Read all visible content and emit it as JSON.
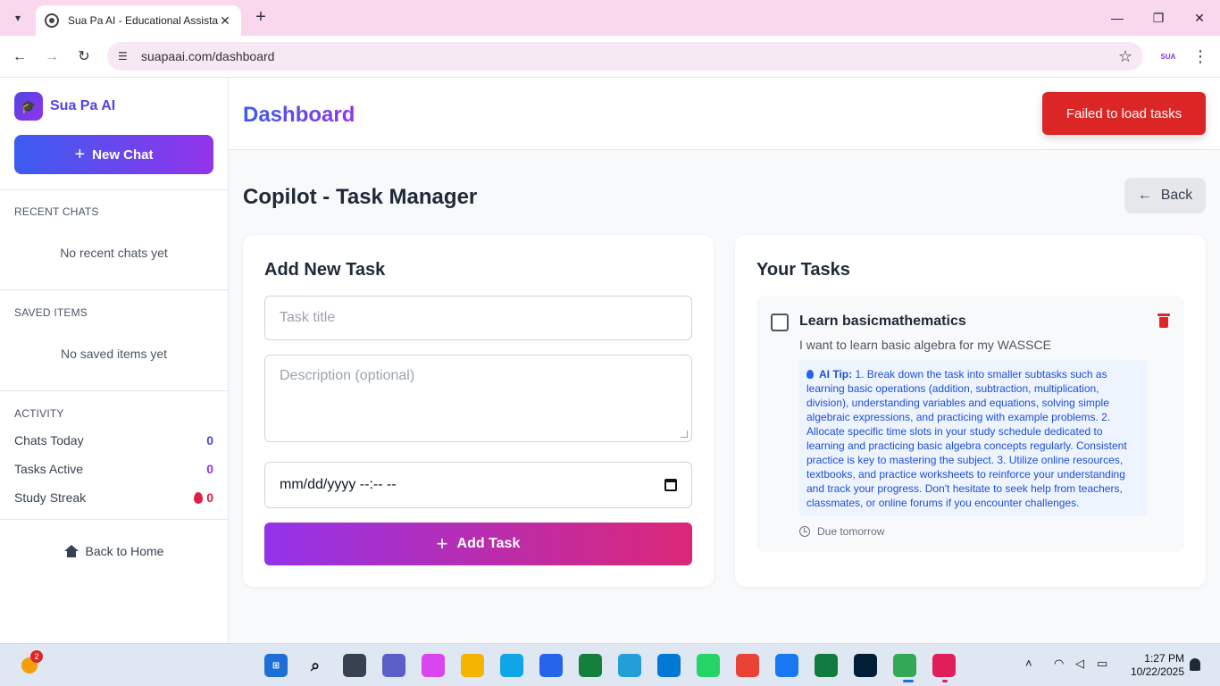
{
  "browser": {
    "tab_title": "Sua Pa AI - Educational Assistant",
    "tab_close": "✕",
    "new_tab": "+",
    "url": "suapaai.com/dashboard",
    "profile_label": "SUA"
  },
  "sidebar": {
    "brand": "Sua Pa AI",
    "new_chat_label": "New Chat",
    "recent_chats": {
      "title": "RECENT CHATS",
      "empty": "No recent chats yet"
    },
    "saved_items": {
      "title": "SAVED ITEMS",
      "empty": "No saved items yet"
    },
    "activity": {
      "title": "ACTIVITY",
      "items": [
        {
          "label": "Chats Today",
          "value": "0"
        },
        {
          "label": "Tasks Active",
          "value": "0"
        },
        {
          "label": "Study Streak",
          "value": "0"
        }
      ]
    },
    "back_home_label": "Back to Home"
  },
  "header": {
    "title": "Dashboard",
    "toast": "Failed to load tasks"
  },
  "main": {
    "page_title": "Copilot - Task Manager",
    "back_label": "Back",
    "add_task": {
      "title": "Add New Task",
      "title_placeholder": "Task title",
      "description_placeholder": "Description (optional)",
      "date_placeholder": "mm/dd/yyyy  --:-- --",
      "submit_label": "Add Task"
    },
    "your_tasks": {
      "title": "Your Tasks",
      "items": [
        {
          "name": "Learn basicmathematics",
          "description": "I want to learn basic algebra for my WASSCE",
          "tip_label": "AI Tip:",
          "tip_text": "1. Break down the task into smaller subtasks such as learning basic operations (addition, subtraction, multiplication, division), understanding variables and equations, solving simple algebraic expressions, and practicing with example problems. 2. Allocate specific time slots in your study schedule dedicated to learning and practicing basic algebra concepts regularly. Consistent practice is key to mastering the subject. 3. Utilize online resources, textbooks, and practice worksheets to reinforce your understanding and track your progress. Don't hesitate to seek help from teachers, classmates, or online forums if you encounter challenges.",
          "due": "Due tomorrow"
        }
      ]
    }
  },
  "taskbar": {
    "weather_badge": "2",
    "time": "1:27 PM",
    "date": "10/22/2025"
  },
  "colors": {
    "accent": "#4f46e5",
    "purple": "#9333ea",
    "pink": "#db2777",
    "error": "#dc2626",
    "tip_bg": "#eef4fe"
  }
}
